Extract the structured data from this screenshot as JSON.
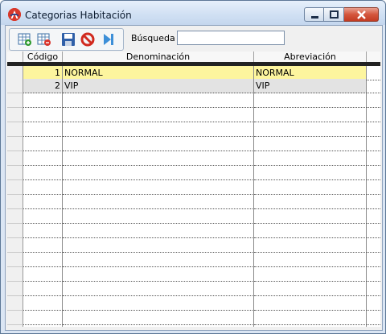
{
  "window": {
    "title": "Categorias Habitación"
  },
  "toolbar": {
    "buttons": [
      {
        "icon": "add-record-icon"
      },
      {
        "icon": "delete-record-icon"
      },
      {
        "icon": "save-icon"
      },
      {
        "icon": "cancel-icon"
      },
      {
        "icon": "next-icon"
      }
    ],
    "search_label": "Búsqueda",
    "search_value": ""
  },
  "grid": {
    "columns": [
      "Código",
      "Denominación",
      "Abreviación"
    ],
    "rows": [
      {
        "codigo": "1",
        "denominacion": "NORMAL",
        "abreviacion": "NORMAL",
        "selected": true
      },
      {
        "codigo": "2",
        "denominacion": "VIP",
        "abreviacion": "VIP",
        "selected": false
      }
    ]
  },
  "colors": {
    "selected_row": "#fdf59e",
    "alternate_row": "#e3e3e3",
    "close_button": "#c33b22"
  }
}
